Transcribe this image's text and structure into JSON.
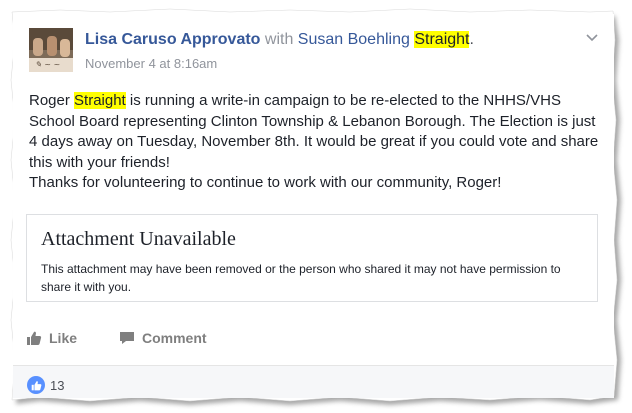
{
  "post": {
    "author": "Lisa Caruso Approvato",
    "with_word": "with",
    "tagged_first": "Susan Boehling",
    "tagged_last": "Straight",
    "tagged_end": ".",
    "timestamp": "November 4 at 8:16am",
    "body_prefix": "Roger",
    "body_highlight": "Straight",
    "body_rest": "is running a write-in campaign to be re-elected to the NHHS/VHS School Board representing Clinton Township & Lebanon Borough. The Election is just 4 days away on Tuesday, November 8th. It would be great if you could vote and share this with your friends!",
    "body_line2": "Thanks for volunteering to continue to work with our community, Roger!"
  },
  "attachment": {
    "title": "Attachment Unavailable",
    "description": "This attachment may have been removed or the person who shared it may not have permission to share it with you."
  },
  "actions": {
    "like_label": "Like",
    "comment_label": "Comment"
  },
  "reactions": {
    "count": "13"
  },
  "icons": {
    "like": "thumbs-up-icon",
    "comment": "comment-bubble-icon",
    "menu": "chevron-down-icon",
    "reaction": "like-reaction-icon"
  },
  "colors": {
    "link": "#365899",
    "highlight": "#ffff00",
    "meta": "#90949c",
    "reaction": "#5890ff"
  }
}
